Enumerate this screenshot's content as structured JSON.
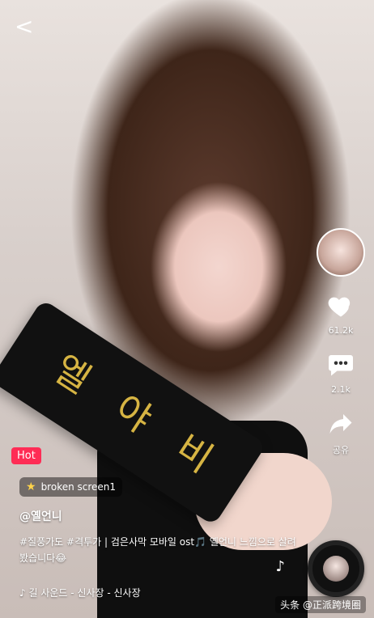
{
  "top": {
    "back_label": "<"
  },
  "side": {
    "like_count": "61.2k",
    "comment_count": "2.1k",
    "share_label": "공유"
  },
  "belt_glyphs": [
    "엘",
    "야",
    "비"
  ],
  "overlay": {
    "hot_label": "Hot",
    "sound_chip": "broken screen1",
    "username": "@옐언니",
    "caption": "#질풍가도 #격투가 | 검은사막 모바일 ost🎵 옐언니 느낌으로 살려봤습니다😂",
    "sound_line": "♪ 길 사운드 - 신사장 - 신사장"
  },
  "watermark": "头条 @正派跨境圈"
}
